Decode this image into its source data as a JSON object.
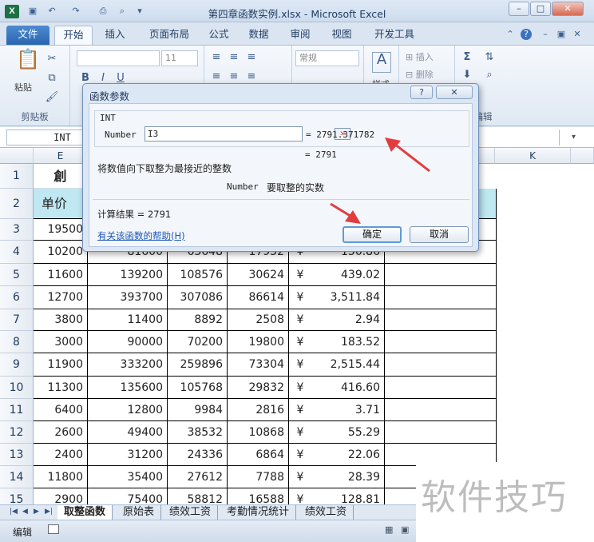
{
  "window": {
    "title": "第四章函数实例.xlsx - Microsoft Excel",
    "minimize": "–",
    "maximize": "□",
    "close": "✕"
  },
  "tabs": [
    "文件",
    "开始",
    "插入",
    "页面布局",
    "公式",
    "数据",
    "审阅",
    "视图",
    "开发工具"
  ],
  "ribbon": {
    "paste_label": "粘贴",
    "clipboard_label": "剪贴板",
    "font_size": "11",
    "number_format": "常规",
    "insert_label": "插入",
    "delete_label": "删除",
    "style_label": "样式",
    "edit_label": "编辑"
  },
  "formula_bar": {
    "name_box": "INT"
  },
  "columns": [
    "E",
    "K"
  ],
  "rows": [
    "1",
    "2",
    "3",
    "4",
    "5",
    "6",
    "7",
    "8",
    "9",
    "10",
    "11",
    "12",
    "13",
    "14",
    "15"
  ],
  "header_row": {
    "row1_partial": "創",
    "unit_price": "单价"
  },
  "table_rows": [
    {
      "e": "19500",
      "f": "",
      "g": "",
      "h": "",
      "y": "",
      "v": ""
    },
    {
      "e": "10200",
      "f": "81600",
      "g": "63648",
      "h": "17952",
      "y": "¥",
      "v": "150.86"
    },
    {
      "e": "11600",
      "f": "139200",
      "g": "108576",
      "h": "30624",
      "y": "¥",
      "v": "439.02"
    },
    {
      "e": "12700",
      "f": "393700",
      "g": "307086",
      "h": "86614",
      "y": "¥",
      "v": "3,511.84"
    },
    {
      "e": "3800",
      "f": "11400",
      "g": "8892",
      "h": "2508",
      "y": "¥",
      "v": "2.94"
    },
    {
      "e": "3000",
      "f": "90000",
      "g": "70200",
      "h": "19800",
      "y": "¥",
      "v": "183.52"
    },
    {
      "e": "11900",
      "f": "333200",
      "g": "259896",
      "h": "73304",
      "y": "¥",
      "v": "2,515.44"
    },
    {
      "e": "11300",
      "f": "135600",
      "g": "105768",
      "h": "29832",
      "y": "¥",
      "v": "416.60"
    },
    {
      "e": "6400",
      "f": "12800",
      "g": "9984",
      "h": "2816",
      "y": "¥",
      "v": "3.71"
    },
    {
      "e": "2600",
      "f": "49400",
      "g": "38532",
      "h": "10868",
      "y": "¥",
      "v": "55.29"
    },
    {
      "e": "2400",
      "f": "31200",
      "g": "24336",
      "h": "6864",
      "y": "¥",
      "v": "22.06"
    },
    {
      "e": "11800",
      "f": "35400",
      "g": "27612",
      "h": "7788",
      "y": "¥",
      "v": "28.39"
    },
    {
      "e": "2900",
      "f": "75400",
      "g": "58812",
      "h": "16588",
      "y": "¥",
      "v": "128.81"
    }
  ],
  "sheets": [
    "取整函数",
    "原始表",
    "绩效工资",
    "考勤情况统计",
    "绩效工资"
  ],
  "status": {
    "mode": "编辑"
  },
  "dialog": {
    "title": "函数参数",
    "function_name": "INT",
    "arg_label": "Number",
    "arg_value": "I3",
    "arg_result": "= 2791.371782",
    "func_result": "= 2791",
    "description": "将数值向下取整为最接近的整数",
    "arg_help_name": "Number",
    "arg_help_text": "要取整的实数",
    "calc_result": "计算结果 = 2791",
    "help_link": "有关该函数的帮助(H)",
    "ok": "确定",
    "cancel": "取消",
    "help_btn": "?",
    "close_btn": "✕"
  },
  "watermark": "软件技巧",
  "colors": {
    "header_fill": "#bfe8f2",
    "highlight_box": "#e23d3d",
    "arrow": "#e23d3d"
  }
}
